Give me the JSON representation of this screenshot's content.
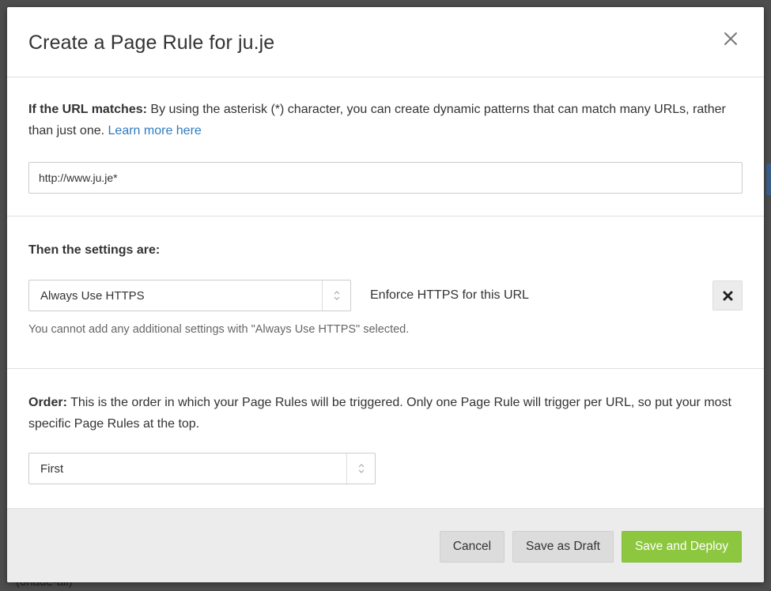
{
  "colors": {
    "accent_link": "#2f7bbf",
    "primary_button": "#8dc73f",
    "backdrop": "#4d4d4d"
  },
  "modal": {
    "title": "Create a Page Rule for ju.je",
    "close_icon": "close-icon"
  },
  "url_section": {
    "label": "If the URL matches:",
    "description": " By using the asterisk (*) character, you can create dynamic patterns that can match many URLs, rather than just one. ",
    "link_text": "Learn more here",
    "input_value": "http://www.ju.je*"
  },
  "settings_section": {
    "label": "Then the settings are:",
    "setting_value": "Always Use HTTPS",
    "setting_description": "Enforce HTTPS for this URL",
    "remove_icon": "times-icon",
    "help_text": "You cannot add any additional settings with \"Always Use HTTPS\" selected."
  },
  "order_section": {
    "label": "Order:",
    "description": " This is the order in which your Page Rules will be triggered. Only one Page Rule will trigger per URL, so put your most specific Page Rules at the top.",
    "order_value": "First"
  },
  "footer": {
    "cancel_label": "Cancel",
    "draft_label": "Save as Draft",
    "deploy_label": "Save and Deploy"
  },
  "background": {
    "bottom_fragment": "(onade-ail)"
  }
}
